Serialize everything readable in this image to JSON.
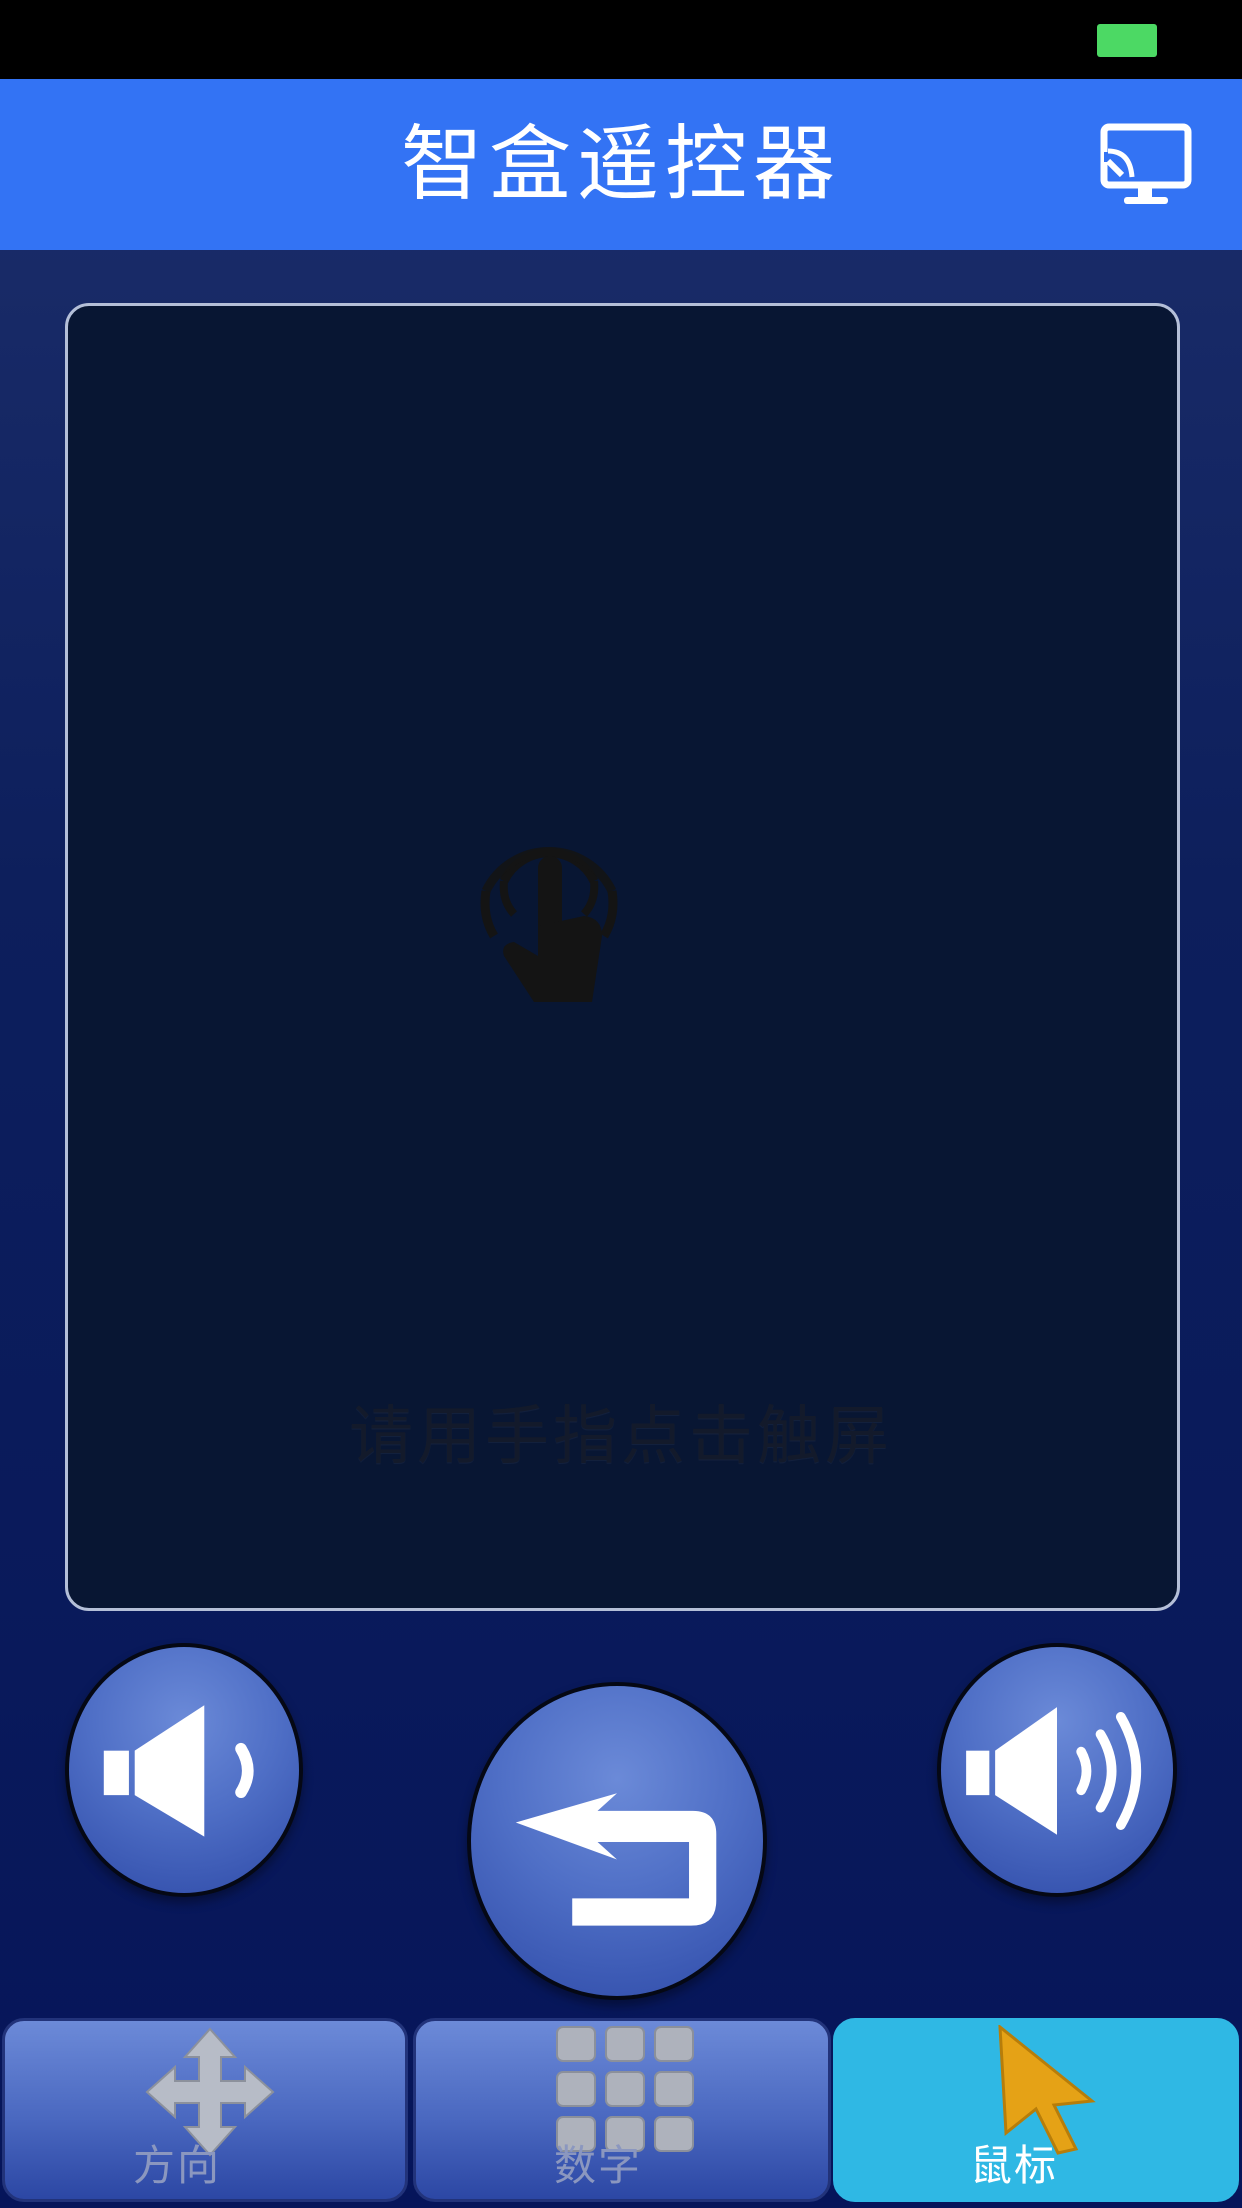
{
  "status_bar": {
    "battery_color": "#4cd964"
  },
  "header": {
    "title": "智盒遥控器",
    "background": "#3373f4",
    "cast_icon": "monitor-cast-icon"
  },
  "touchpad": {
    "hint": "请用手指点击触屏",
    "icon": "touch-hand-icon"
  },
  "controls": {
    "volume_down_icon": "volume-down-icon",
    "back_icon": "back-arrow-icon",
    "volume_up_icon": "volume-up-icon"
  },
  "tabs": [
    {
      "label": "方向",
      "icon": "direction-arrows-icon",
      "selected": false
    },
    {
      "label": "数字",
      "icon": "number-grid-icon",
      "selected": false
    },
    {
      "label": "鼠标",
      "icon": "mouse-pointer-icon",
      "selected": true
    }
  ],
  "colors": {
    "accent": "#3373f4",
    "selected_tab": "#2fb8e4",
    "background": "#0d1f5c"
  }
}
